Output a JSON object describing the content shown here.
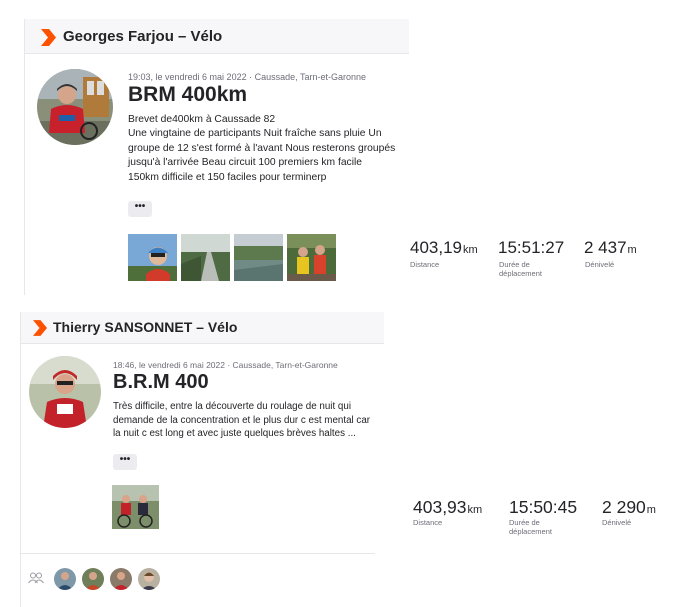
{
  "activities": [
    {
      "athlete_header": "Georges Farjou – Vélo",
      "timestamp_location": "19:03, le vendredi 6 mai 2022 · Caussade, Tarn-et-Garonne",
      "title": "BRM 400km",
      "description": [
        "Brevet de400km à Caussade 82",
        "Une vingtaine de participants Nuit fraîche sans pluie Un groupe de 12 s'est formé à l'avant Nous resterons groupés jusqu'à l'arrivée Beau circuit 100 premiers km facile",
        "150km difficile et 150 faciles pour terminerp"
      ],
      "more_label": "•••",
      "stats": [
        {
          "value": "403,19",
          "unit": "km",
          "label": "Distance"
        },
        {
          "value": "15:51:27",
          "unit": "",
          "label": "Durée de déplacement"
        },
        {
          "value": "2 437",
          "unit": "m",
          "label": "Dénivelé"
        }
      ]
    },
    {
      "athlete_header": "Thierry SANSONNET – Vélo",
      "timestamp_location": "18:46, le vendredi 6 mai 2022 · Caussade, Tarn-et-Garonne",
      "title": "B.R.M 400",
      "description": [
        "Très difficile, entre la découverte du roulage de nuit qui demande de la concentration et le plus dur c est mental car la nuit c est long et avec juste quelques brèves haltes ..."
      ],
      "more_label": "•••",
      "stats": [
        {
          "value": "403,93",
          "unit": "km",
          "label": "Distance"
        },
        {
          "value": "15:50:45",
          "unit": "",
          "label": "Durée de déplacement"
        },
        {
          "value": "2 290",
          "unit": "m",
          "label": "Dénivelé"
        }
      ]
    }
  ],
  "colors": {
    "strava_orange": "#fc5200",
    "header_bg": "#f7f7fa",
    "text": "#242428",
    "muted": "#6d6d78"
  }
}
